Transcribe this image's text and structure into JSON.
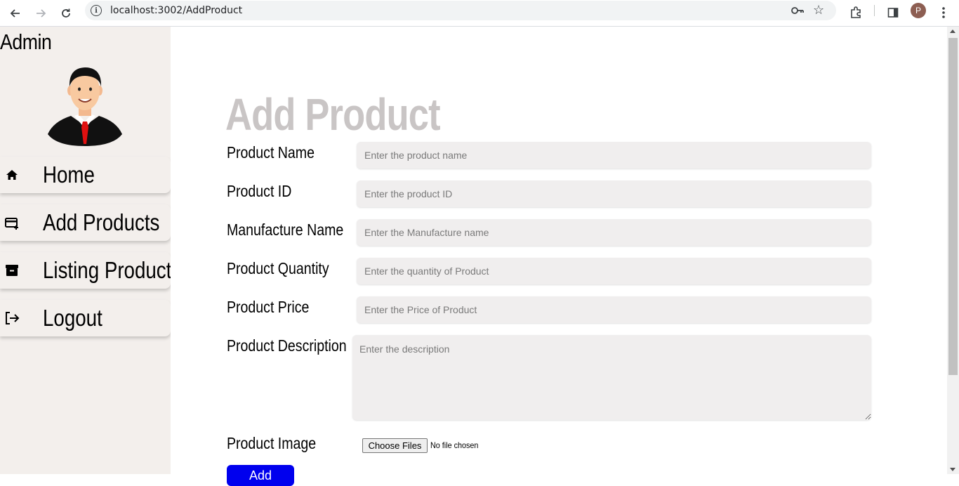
{
  "browser": {
    "url": "localhost:3002/AddProduct",
    "profile_initial": "P"
  },
  "sidebar": {
    "title": "Admin",
    "items": [
      {
        "label": "Home",
        "icon": "home-icon"
      },
      {
        "label": "Add Products",
        "icon": "add-card-icon"
      },
      {
        "label": "Listing Product",
        "icon": "archive-icon"
      },
      {
        "label": "Logout",
        "icon": "logout-icon"
      }
    ]
  },
  "form": {
    "title": "Add Product",
    "fields": [
      {
        "label": "Product Name",
        "placeholder": "Enter the product name",
        "value": ""
      },
      {
        "label": "Product ID",
        "placeholder": "Enter the product ID",
        "value": ""
      },
      {
        "label": "Manufacture Name",
        "placeholder": "Enter the Manufacture name",
        "value": ""
      },
      {
        "label": "Product Quantity",
        "placeholder": "Enter the quantity of Product",
        "value": ""
      },
      {
        "label": "Product Price",
        "placeholder": "Enter the Price of Product",
        "value": ""
      }
    ],
    "description": {
      "label": "Product Description",
      "placeholder": "Enter the description",
      "value": ""
    },
    "image": {
      "label": "Product Image",
      "button_label": "Choose Files",
      "status": "No file chosen"
    },
    "submit_label": "Add"
  },
  "colors": {
    "sidebar_bg": "#f3efec",
    "title_color": "#c9c5c5",
    "input_bg": "#f0eeee",
    "submit_bg": "#0000ee"
  }
}
